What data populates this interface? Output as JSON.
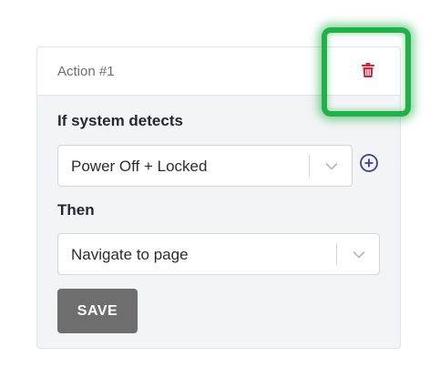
{
  "action_card": {
    "title": "Action #1",
    "delete_icon": "trash-icon",
    "accent_delete": "#d0263a",
    "highlight_color": "#22b04a"
  },
  "condition": {
    "label": "If system detects",
    "selected_value": "Power Off + Locked",
    "add_icon": "plus-circle-icon",
    "add_icon_color": "#3a3f9a"
  },
  "action": {
    "label": "Then",
    "selected_value": "Navigate to page"
  },
  "save_button": {
    "label": "SAVE",
    "color": "#6e6e6e"
  }
}
